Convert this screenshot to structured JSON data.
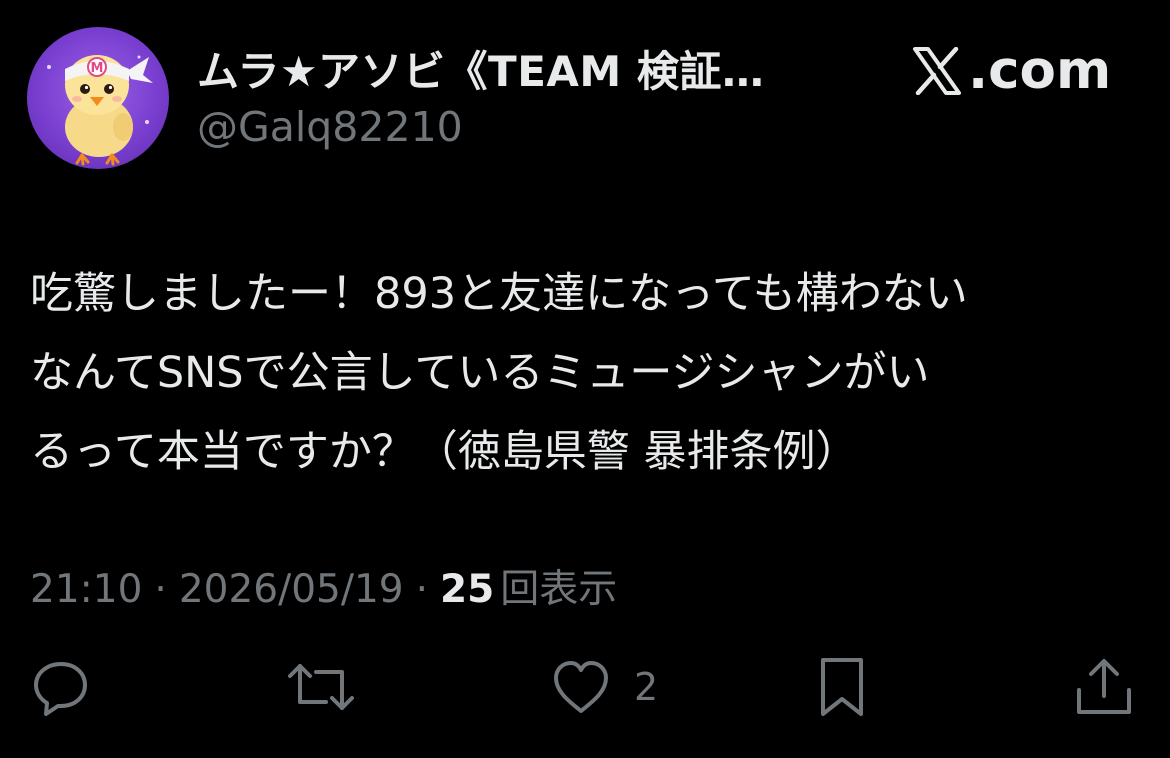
{
  "header": {
    "display_name": "ムラ★アソビ《TEAM 検証…",
    "handle": "@Galq82210",
    "brand": ".com",
    "brand_icon": "x-logo-icon",
    "avatar": "chick-with-headband-avatar",
    "avatar_badge": "M"
  },
  "tweet": {
    "lines": [
      "吃驚しましたー！893と友達になっても構わない",
      "なんてSNSで公言しているミュージシャンがい",
      "るって本当ですか？（徳島県警 暴排条例）"
    ]
  },
  "meta": {
    "time": "21:10",
    "separator": "·",
    "date": "2026/05/19",
    "views_count": "25",
    "views_label": "回表示"
  },
  "actions": {
    "reply_icon": "reply-icon",
    "retweet_icon": "retweet-icon",
    "like_icon": "heart-icon",
    "like_count": "2",
    "bookmark_icon": "bookmark-icon",
    "share_icon": "share-icon"
  },
  "colors": {
    "background": "#000000",
    "primary_text": "#e7e9ea",
    "secondary_text": "#71767b",
    "avatar_bg": "#7a3fd0"
  }
}
